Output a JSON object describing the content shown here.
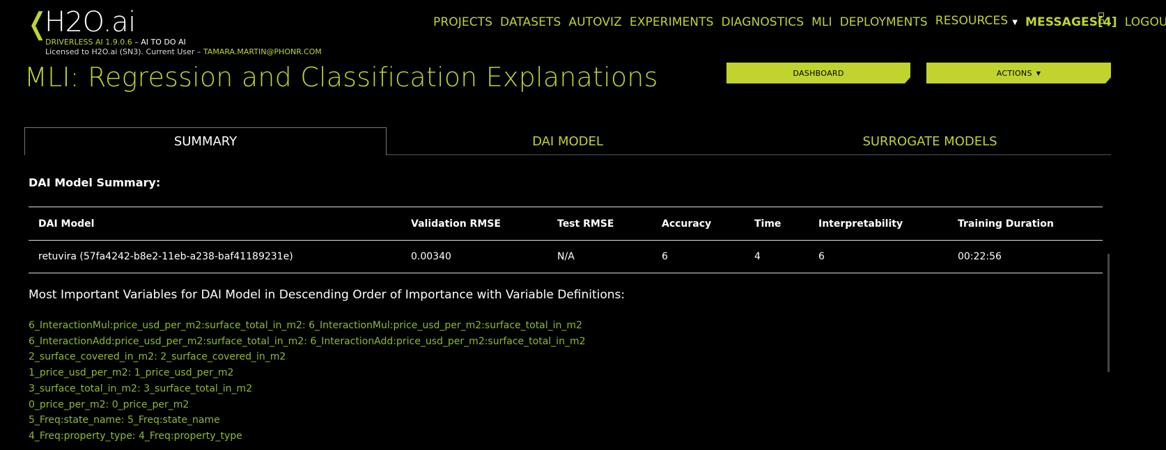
{
  "header": {
    "logo_chevron": "❬",
    "logo_text": "H2O.ai",
    "version_accent": "DRIVERLESS AI 1.9.0.6",
    "version_rest": " – AI TO DO AI",
    "license_prefix": "Licensed to H2O.ai (SN3). Current User – ",
    "license_user": "TAMARA.MARTIN@PHONR.COM"
  },
  "nav": {
    "projects": "PROJECTS",
    "datasets": "DATASETS",
    "autoviz": "AUTOVIZ",
    "experiments": "EXPERIMENTS",
    "diagnostics": "DIAGNOSTICS",
    "mli": "MLI",
    "deployments": "DEPLOYMENTS",
    "resources": "RESOURCES",
    "messages": "MESSAGES[4]",
    "logout": "LOGOUT"
  },
  "page": {
    "title": "MLI: Regression and Classification Explanations",
    "dashboard_label": "DASHBOARD",
    "actions_label": "ACTIONS"
  },
  "tabs": {
    "summary": "SUMMARY",
    "dai_model": "DAI MODEL",
    "surrogate_models": "SURROGATE MODELS"
  },
  "summary": {
    "section_title": "DAI Model Summary:",
    "columns": {
      "model": "DAI Model",
      "validation_rmse": "Validation RMSE",
      "test_rmse": "Test RMSE",
      "accuracy": "Accuracy",
      "time": "Time",
      "interpretability": "Interpretability",
      "training_duration": "Training Duration"
    },
    "row": {
      "model": "retuvira (57fa4242-b8e2-11eb-a238-baf41189231e)",
      "validation_rmse": "0.00340",
      "test_rmse": "N/A",
      "accuracy": "6",
      "time": "4",
      "interpretability": "6",
      "training_duration": "00:22:56"
    }
  },
  "variables": {
    "heading": "Most Important Variables for DAI Model in Descending Order of Importance with Variable Definitions:",
    "items": [
      "6_InteractionMul:price_usd_per_m2:surface_total_in_m2: 6_InteractionMul:price_usd_per_m2:surface_total_in_m2",
      "6_InteractionAdd:price_usd_per_m2:surface_total_in_m2: 6_InteractionAdd:price_usd_per_m2:surface_total_in_m2",
      "2_surface_covered_in_m2: 2_surface_covered_in_m2",
      "1_price_usd_per_m2: 1_price_usd_per_m2",
      "3_surface_total_in_m2: 3_surface_total_in_m2",
      "0_price_per_m2: 0_price_per_m2",
      "5_Freq:state_name: 5_Freq:state_name",
      "4_Freq:property_type: 4_Freq:property_type"
    ]
  },
  "colors": {
    "accent": "#c1d32f",
    "variable_text": "#8bbb2e",
    "background": "#000000"
  }
}
